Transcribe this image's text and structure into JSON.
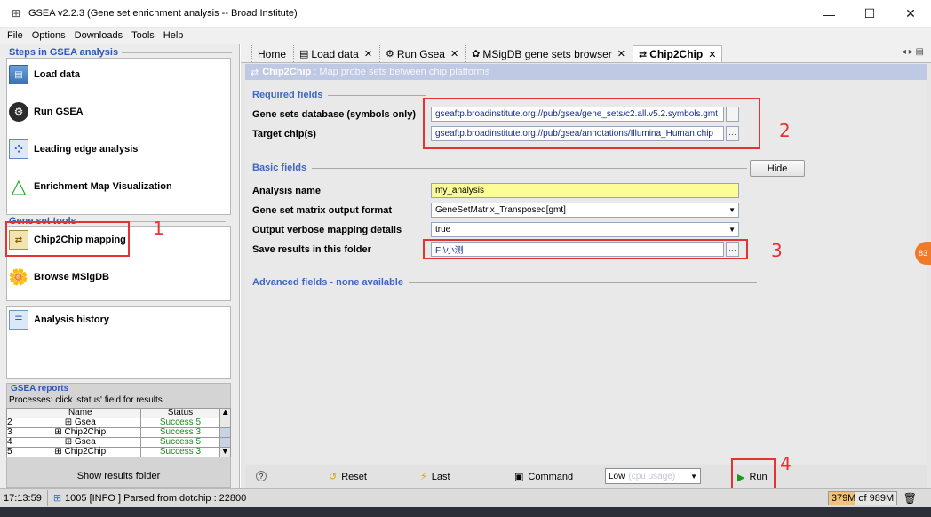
{
  "window": {
    "title": "GSEA v2.2.3 (Gene set enrichment analysis -- Broad Institute)",
    "minimize": "—",
    "maximize": "☐",
    "close": "✕"
  },
  "menu": [
    "File",
    "Options",
    "Downloads",
    "Tools",
    "Help"
  ],
  "left": {
    "steps_title": "Steps in GSEA analysis",
    "steps": [
      {
        "label": "Load data",
        "icon": "load-data-icon"
      },
      {
        "label": "Run GSEA",
        "icon": "run-gsea-icon"
      },
      {
        "label": "Leading edge analysis",
        "icon": "leading-edge-icon"
      },
      {
        "label": "Enrichment Map Visualization",
        "icon": "enrichment-map-icon"
      }
    ],
    "tools_title": "Gene set tools",
    "tools": [
      {
        "label": "Chip2Chip mapping",
        "icon": "chip2chip-icon"
      },
      {
        "label": "Browse MSigDB",
        "icon": "msigdb-icon"
      }
    ],
    "history_label": "Analysis history",
    "reports_title": "GSEA reports",
    "reports_hint": "Processes: click 'status' field for results",
    "reports_columns": [
      "Name",
      "Status"
    ],
    "reports_rows": [
      {
        "num": "2",
        "name": "Gsea",
        "status": "Success 5"
      },
      {
        "num": "3",
        "name": "Chip2Chip",
        "status": "Success 3"
      },
      {
        "num": "4",
        "name": "Gsea",
        "status": "Success 5"
      },
      {
        "num": "5",
        "name": "Chip2Chip",
        "status": "Success 3"
      }
    ],
    "show_results": "Show results folder",
    "annotation_1": "1"
  },
  "tabs": [
    {
      "label": "Home",
      "icon": ""
    },
    {
      "label": "Load data",
      "icon": "load-data-icon"
    },
    {
      "label": "Run Gsea",
      "icon": "run-gsea-icon"
    },
    {
      "label": "MSigDB gene sets browser",
      "icon": "msigdb-icon"
    },
    {
      "label": "Chip2Chip",
      "icon": "chip2chip-icon",
      "active": true
    }
  ],
  "content": {
    "header_title": "Chip2Chip",
    "header_desc": ": Map probe sets between chip platforms",
    "required_title": "Required fields",
    "fields_required": [
      {
        "label": "Gene sets database (symbols only)",
        "value": "gseaftp.broadinstitute.org://pub/gsea/gene_sets/c2.all.v5.2.symbols.gmt"
      },
      {
        "label": "Target chip(s)",
        "value": "gseaftp.broadinstitute.org://pub/gsea/annotations/Illumina_Human.chip"
      }
    ],
    "basic_title": "Basic fields",
    "hide_label": "Hide",
    "analysis_name_label": "Analysis name",
    "analysis_name_value": "my_analysis",
    "matrix_format_label": "Gene set matrix output format",
    "matrix_format_value": "GeneSetMatrix_Transposed[gmt]",
    "verbose_label": "Output verbose mapping details",
    "verbose_value": "true",
    "save_label": "Save results in this folder",
    "save_value": "F:\\小测",
    "advanced_title": "Advanced fields - none available",
    "annotation_2": "2",
    "annotation_3": "3",
    "annotation_4": "4",
    "browse_label": "···"
  },
  "toolbar": {
    "help": "?",
    "reset": "Reset",
    "last": "Last",
    "command": "Command",
    "cpu_value": "Low",
    "cpu_hint": "(cpu usage)",
    "run": "Run"
  },
  "status": {
    "time": "17:13:59",
    "message": "1005 [INFO ] Parsed from dotchip : 22800",
    "memory": "379M of 989M",
    "memory_fraction": 0.38,
    "bubble": "83"
  },
  "colors": {
    "accent_blue": "#2c57b8",
    "annotation_red": "#e53333",
    "header_strip": "#bfc9e3",
    "name_field_yellow": "#fdfd97",
    "success_green": "#1f8a1f"
  }
}
